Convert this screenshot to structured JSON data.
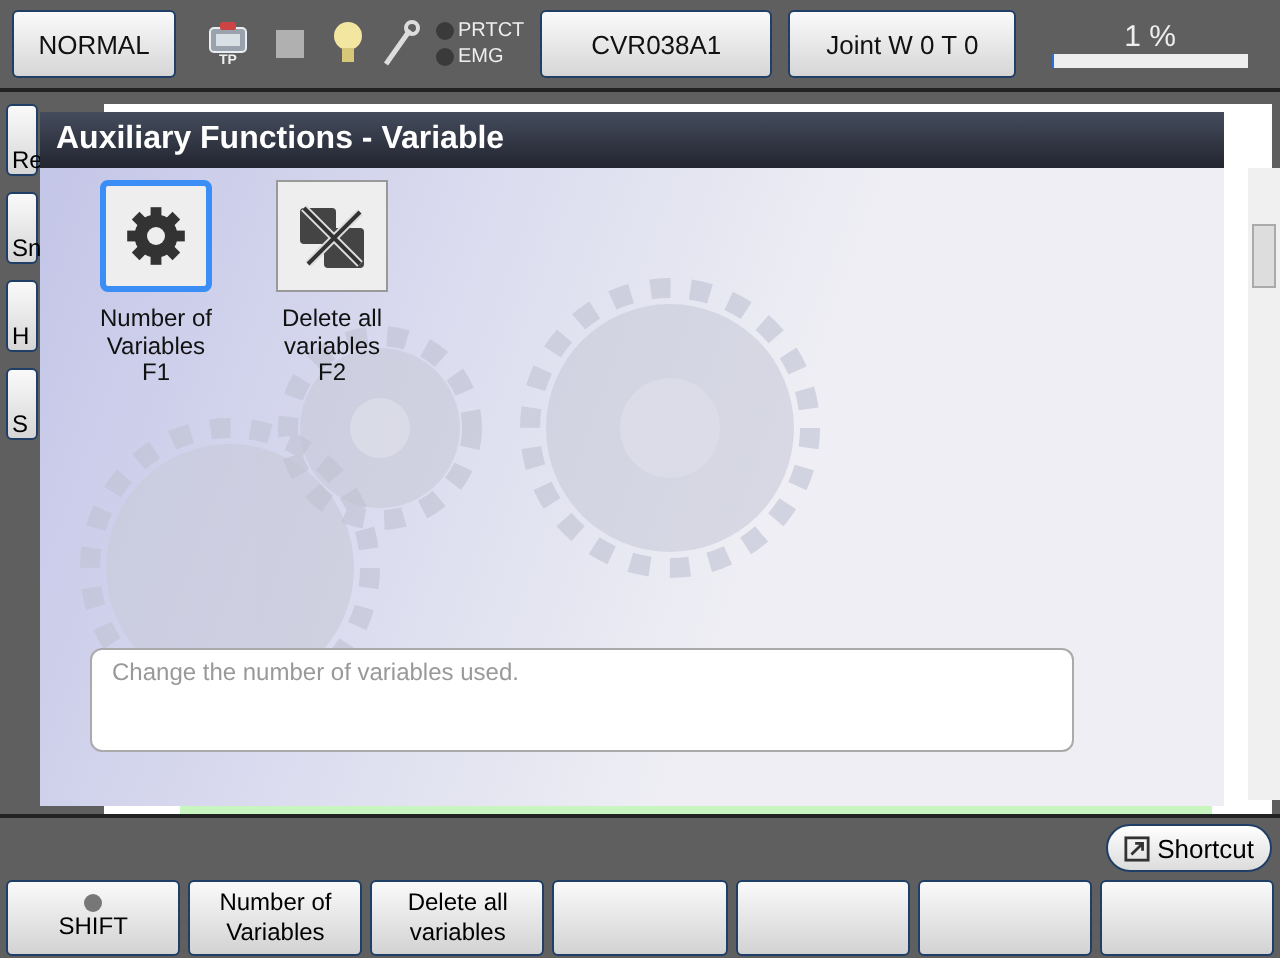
{
  "status_bar": {
    "mode": "NORMAL",
    "tp_label": "TP",
    "indicators": [
      {
        "label": "PRTCT",
        "on": false
      },
      {
        "label": "EMG",
        "on": false
      }
    ],
    "job": "CVR038A1",
    "coords": "Joint  W 0 T 0",
    "progress_label": "1 %",
    "progress": {
      "level": 0.01
    }
  },
  "side_buttons": [
    "Re",
    "Sn",
    "H",
    "S"
  ],
  "dialog": {
    "title": "Auxiliary Functions - Variable",
    "items": [
      {
        "label": "Number of Variables",
        "key": "F1",
        "selected": true,
        "kind": "gear"
      },
      {
        "label": "Delete all variables",
        "key": "F2",
        "selected": false,
        "kind": "dice"
      }
    ],
    "description": "Change the number of variables used."
  },
  "shortcut": "Shortcut",
  "function_keys": [
    {
      "kind": "shift",
      "label": "SHIFT",
      "on": false
    },
    {
      "kind": "text",
      "label": "Number of Variables"
    },
    {
      "kind": "text",
      "label": "Delete all variables"
    },
    {
      "kind": "blank"
    },
    {
      "kind": "blank"
    },
    {
      "kind": "blank"
    },
    {
      "kind": "blank"
    }
  ]
}
